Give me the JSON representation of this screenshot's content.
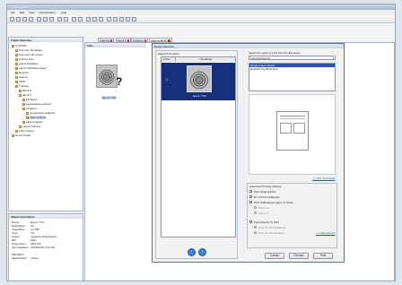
{
  "menu": [
    "File",
    "Edit",
    "View",
    "Administration",
    "Help"
  ],
  "folders": {
    "header": "Folder Selection",
    "tree": [
      "SYSTEM",
      "Forensic Templates",
      "Forensic Lab Cases",
      "Archive Tree",
      "Latent Workflow",
      "Latent Workflow Cases",
      "Reports",
      "Search",
      "TEST",
      "Training",
      "latent 8",
      "latent 9",
      "identified",
      "comparative analysis",
      "rangeme",
      "comparative analysis",
      "edge analysis",
      "edge analysis",
      "Latent Training",
      "CSVI Cases",
      "Home Folder"
    ]
  },
  "info": {
    "header": "Object Information",
    "rows": [
      {
        "k": "Name:",
        "v": "latent 7.TIF"
      },
      {
        "k": "Description:",
        "v": "tec"
      },
      {
        "k": "ImageSize:",
        "v": "1.0 MB"
      },
      {
        "k": "Type:",
        "v": "TIF"
      },
      {
        "k": "Owner:",
        "v": "rangeme Aftsq Rapnd"
      },
      {
        "k": "DPI:",
        "v": "Plain"
      },
      {
        "k": "Dimensions:",
        "v": "966x726"
      },
      {
        "k": "Last Updated:",
        "v": "10/30/2015 2:21 PM"
      }
    ],
    "extra": [
      {
        "k": "PROJECT",
        "v": ""
      },
      {
        "k": "Identification:",
        "v": "Yellow"
      }
    ]
  },
  "files": {
    "header": "Files",
    "caption": "latent 7.TIF",
    "question": "?"
  },
  "tabs": [
    "Training",
    "latent 9",
    "rangeme",
    "edge analysis"
  ],
  "dialog": {
    "title": "Report Selection",
    "print_order": {
      "label": "Select Print Order",
      "col_order": "Order",
      "col_thumb": "Thumbnail",
      "row_index": "1",
      "row_caption": "latent 7.TIF"
    },
    "report": {
      "label": "Select the report to print from the list below",
      "selected": "Training Reports",
      "list": [
        "Single Image Report",
        "Detailed Tag Build Now"
      ]
    },
    "hide_thumbnail": "<< Hide Thumbnail",
    "advanced": {
      "label": "Advanced Printing Options",
      "options": [
        "Print Original Files",
        "Do Not Print Markups",
        "Print Calibrated Images To Scale"
      ],
      "scale_options": [
        "Print 1:1",
        "Print 2:1"
      ],
      "print_directly": "Print Directly To PDF",
      "pdf_options": [
        "Save To This Database",
        "Save To The Desktop"
      ],
      "hide_options": "<< Hide Options"
    },
    "buttons": {
      "cancel": "Cancel",
      "preview": "Preview",
      "print": "Print"
    }
  }
}
